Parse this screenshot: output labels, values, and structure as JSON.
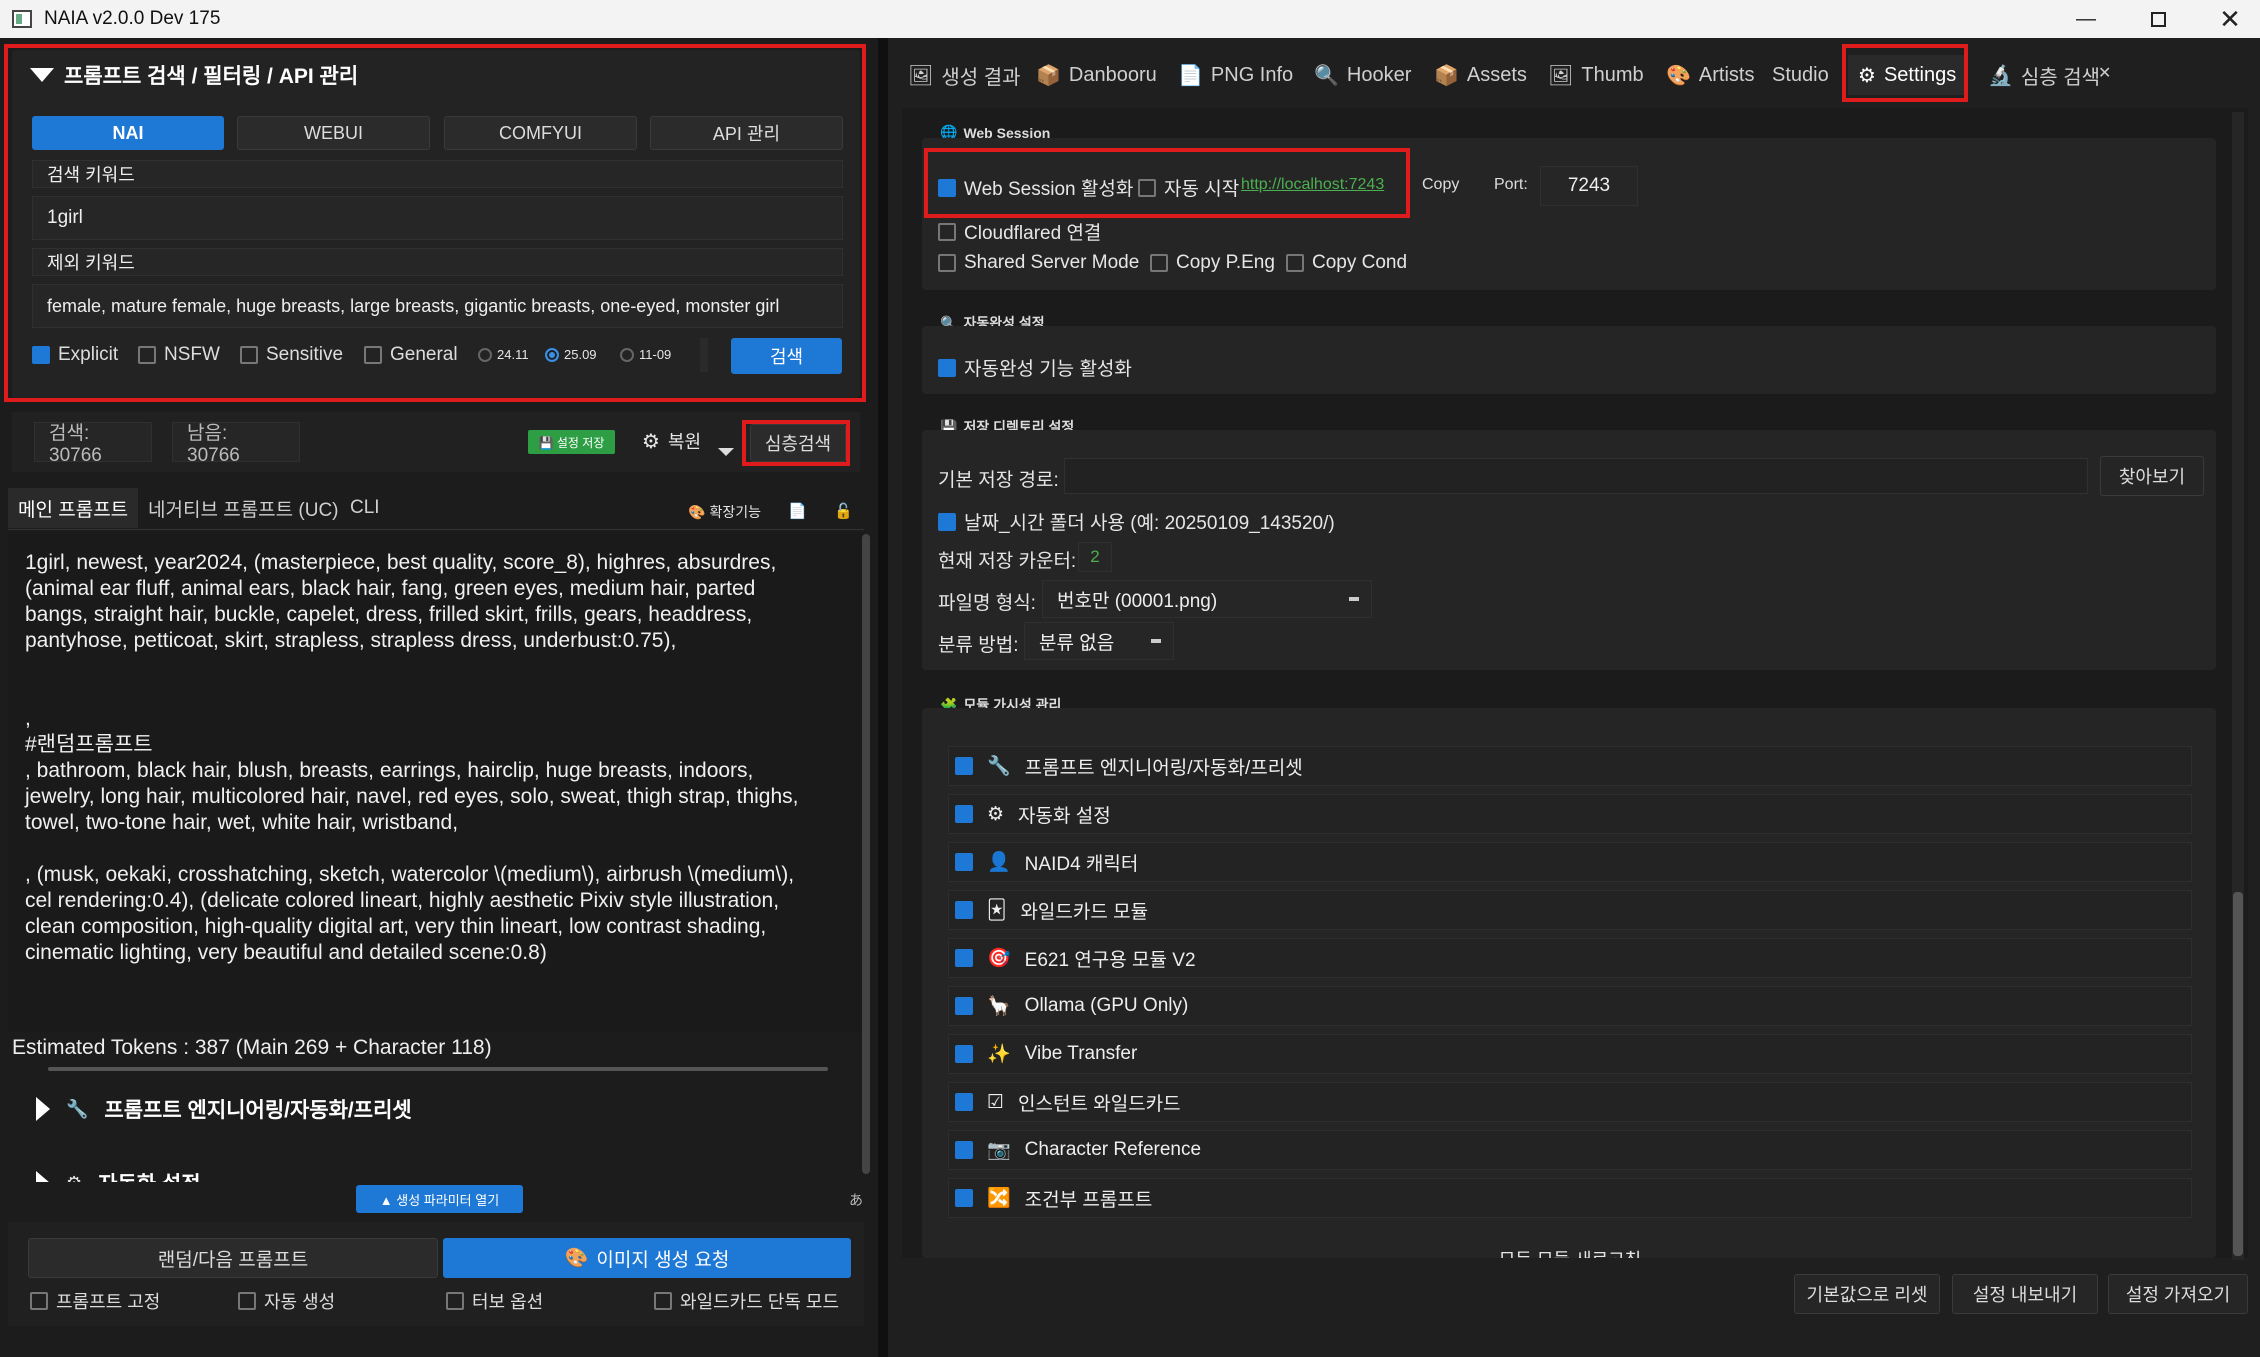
{
  "window": {
    "title": "NAIA v2.0.0 Dev 175"
  },
  "left": {
    "search_header": "프롬프트 검색 / 필터링 / API 관리",
    "api_tabs": [
      "NAI",
      "WEBUI",
      "COMFYUI",
      "API 관리"
    ],
    "search_keyword_label": "검색 키워드",
    "search_keyword_value": "1girl",
    "exclude_keyword_label": "제외 키워드",
    "exclude_keyword_value": "female, mature female, huge breasts, large breasts, gigantic breasts, one-eyed, monster girl",
    "filters": [
      {
        "label": "Explicit",
        "checked": true
      },
      {
        "label": "NSFW",
        "checked": false
      },
      {
        "label": "Sensitive",
        "checked": false
      },
      {
        "label": "General",
        "checked": false
      }
    ],
    "versions": [
      {
        "label": "24.11",
        "selected": false
      },
      {
        "label": "25.09",
        "selected": true
      },
      {
        "label": "11-09",
        "selected": false
      }
    ],
    "search_button": "검색",
    "count_search": "검색: 30766",
    "count_remaining": "남음: 30766",
    "save_settings": "💾 설정 저장",
    "restore": "복원",
    "deep_search": "심층검색",
    "prompt_tabs": [
      "메인 프롬프트",
      "네거티브 프롬프트 (UC)",
      "CLI"
    ],
    "extensions_label": "확장기능",
    "main_prompt": "1girl, newest, year2024, (masterpiece, best quality, score_8), highres, absurdres,\n(animal ear fluff, animal ears, black hair, fang, green eyes, medium hair, parted\nbangs, straight hair, buckle, capelet, dress, frilled skirt, frills, gears, headdress,\npantyhose, petticoat, skirt, strapless, strapless dress, underbust:0.75),\n\n\n,\n#랜덤프롬프트\n, bathroom, black hair, blush, breasts, earrings, hairclip, huge breasts, indoors,\njewelry, long hair, multicolored hair, navel, red eyes, solo, sweat, thigh strap, thighs,\ntowel, two-tone hair, wet, white hair, wristband,\n\n, (musk, oekaki, crosshatching, sketch, watercolor \\(medium\\), airbrush \\(medium\\),\ncel rendering:0.4), (delicate colored lineart, highly aesthetic Pixiv style illustration,\nclean composition, high-quality digital art, very thin lineart, low contrast shading,\ncinematic lighting, very beautiful and detailed scene:0.8)",
    "tokens": "Estimated Tokens : 387 (Main 269 + Character 118)",
    "section_prompt_eng": "프롬프트 엔지니어링/자동화/프리셋",
    "section_automation": "자동화 설정",
    "open_params": "▲ 생성 파라미터 열기",
    "ime_glyph": "あ",
    "random_next": "랜덤/다음 프롬프트",
    "generate": "이미지 생성 요청",
    "bottom_checks": [
      "프롬프트 고정",
      "자동 생성",
      "터보 옵션",
      "와일드카드 단독 모드"
    ]
  },
  "right": {
    "tabs": [
      {
        "label": "생성 결과",
        "icon": "image-icon"
      },
      {
        "label": "Danbooru",
        "icon": "box-icon"
      },
      {
        "label": "PNG Info",
        "icon": "document-icon"
      },
      {
        "label": "Hooker",
        "icon": "magnifier-icon"
      },
      {
        "label": "Assets",
        "icon": "box-icon"
      },
      {
        "label": "Thumb",
        "icon": "image-icon"
      },
      {
        "label": "Artists",
        "icon": "palette-icon"
      },
      {
        "label": "Studio",
        "icon": ""
      },
      {
        "label": "Settings",
        "icon": "gear-icon"
      },
      {
        "label": "심층 검색",
        "icon": "microscope-icon"
      }
    ],
    "close_glyph": "✕",
    "web_session": {
      "title": "Web Session",
      "enable": "Web Session 활성화",
      "auto_start": "자동 시작",
      "url": "http://localhost:7243",
      "copy": "Copy",
      "port_label": "Port:",
      "port_value": "7243",
      "cloudflared": "Cloudflared 연결",
      "shared": "Shared Server Mode",
      "copy_peng": "Copy P.Eng",
      "copy_cond": "Copy Cond"
    },
    "autocomplete": {
      "title": "자동완성 설정",
      "enable": "자동완성 기능 활성화"
    },
    "storage": {
      "title": "저장 디렉토리 설정",
      "base_path_label": "기본 저장 경로:",
      "browse": "찾아보기",
      "date_folder": "날짜_시간 폴더 사용 (예: 20250109_143520/)",
      "counter_label": "현재 저장 카운터:",
      "counter_value": "2",
      "filename_label": "파일명 형식:",
      "filename_value": "번호만 (00001.png)",
      "classify_label": "분류 방법:",
      "classify_value": "분류 없음"
    },
    "modules": {
      "title": "모듈 가시성 관리",
      "items": [
        {
          "label": "프롬프트 엔지니어링/자동화/프리셋",
          "icon": "🔧"
        },
        {
          "label": "자동화 설정",
          "icon": "⚙"
        },
        {
          "label": "NAID4 캐릭터",
          "icon": "👤"
        },
        {
          "label": "와일드카드 모듈",
          "icon": "🃏"
        },
        {
          "label": "E621 연구용 모듈 V2",
          "icon": "🎯"
        },
        {
          "label": "Ollama (GPU Only)",
          "icon": "🦙"
        },
        {
          "label": "Vibe Transfer",
          "icon": "✨"
        },
        {
          "label": "인스턴트 와일드카드",
          "icon": "☑"
        },
        {
          "label": "Character Reference",
          "icon": "📷"
        },
        {
          "label": "조건부 프롬프트",
          "icon": "🔀"
        }
      ],
      "refresh": "모든 모듈 새로고침"
    },
    "footer": [
      "기본값으로 리셋",
      "설정 내보내기",
      "설정 가져오기"
    ]
  },
  "colors": {
    "accent": "#1e78d6",
    "highlight": "#e01b1b",
    "link": "#4caf50",
    "save_badge": "#2e9e44"
  }
}
